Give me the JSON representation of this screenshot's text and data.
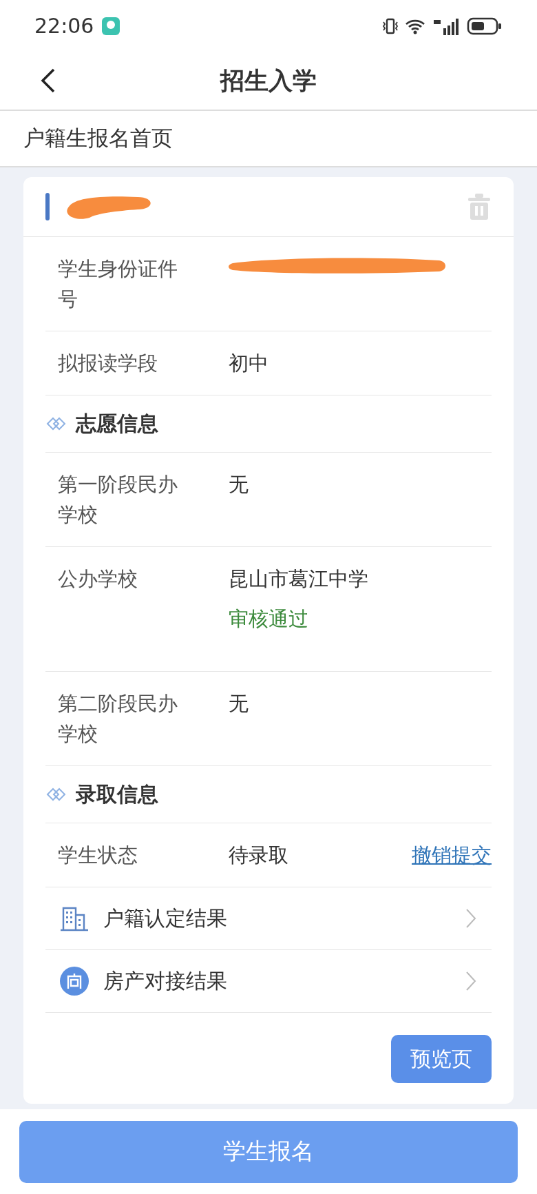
{
  "status_bar": {
    "time": "22:06"
  },
  "header": {
    "title": "招生入学"
  },
  "breadcrumb": "户籍生报名首页",
  "student_card": {
    "rows": [
      {
        "kind": "field",
        "label": "学生身份证件号",
        "redacted": true
      },
      {
        "kind": "field",
        "label": "拟报读学段",
        "value": "初中"
      },
      {
        "kind": "section",
        "label": "志愿信息"
      },
      {
        "kind": "field",
        "label": "第一阶段民办学校",
        "value": "无"
      },
      {
        "kind": "field",
        "label": "公办学校",
        "value": "昆山市葛江中学",
        "note": "审核通过"
      },
      {
        "kind": "field",
        "label": "第二阶段民办学校",
        "value": "无"
      },
      {
        "kind": "section",
        "label": "录取信息"
      },
      {
        "kind": "field",
        "label": "学生状态",
        "value": "待录取",
        "link": "撤销提交"
      }
    ],
    "links": [
      {
        "kind": "building",
        "label": "户籍认定结果"
      },
      {
        "kind": "house",
        "label": "房产对接结果"
      }
    ],
    "preview_button": "预览页"
  },
  "submit_button": "学生报名"
}
